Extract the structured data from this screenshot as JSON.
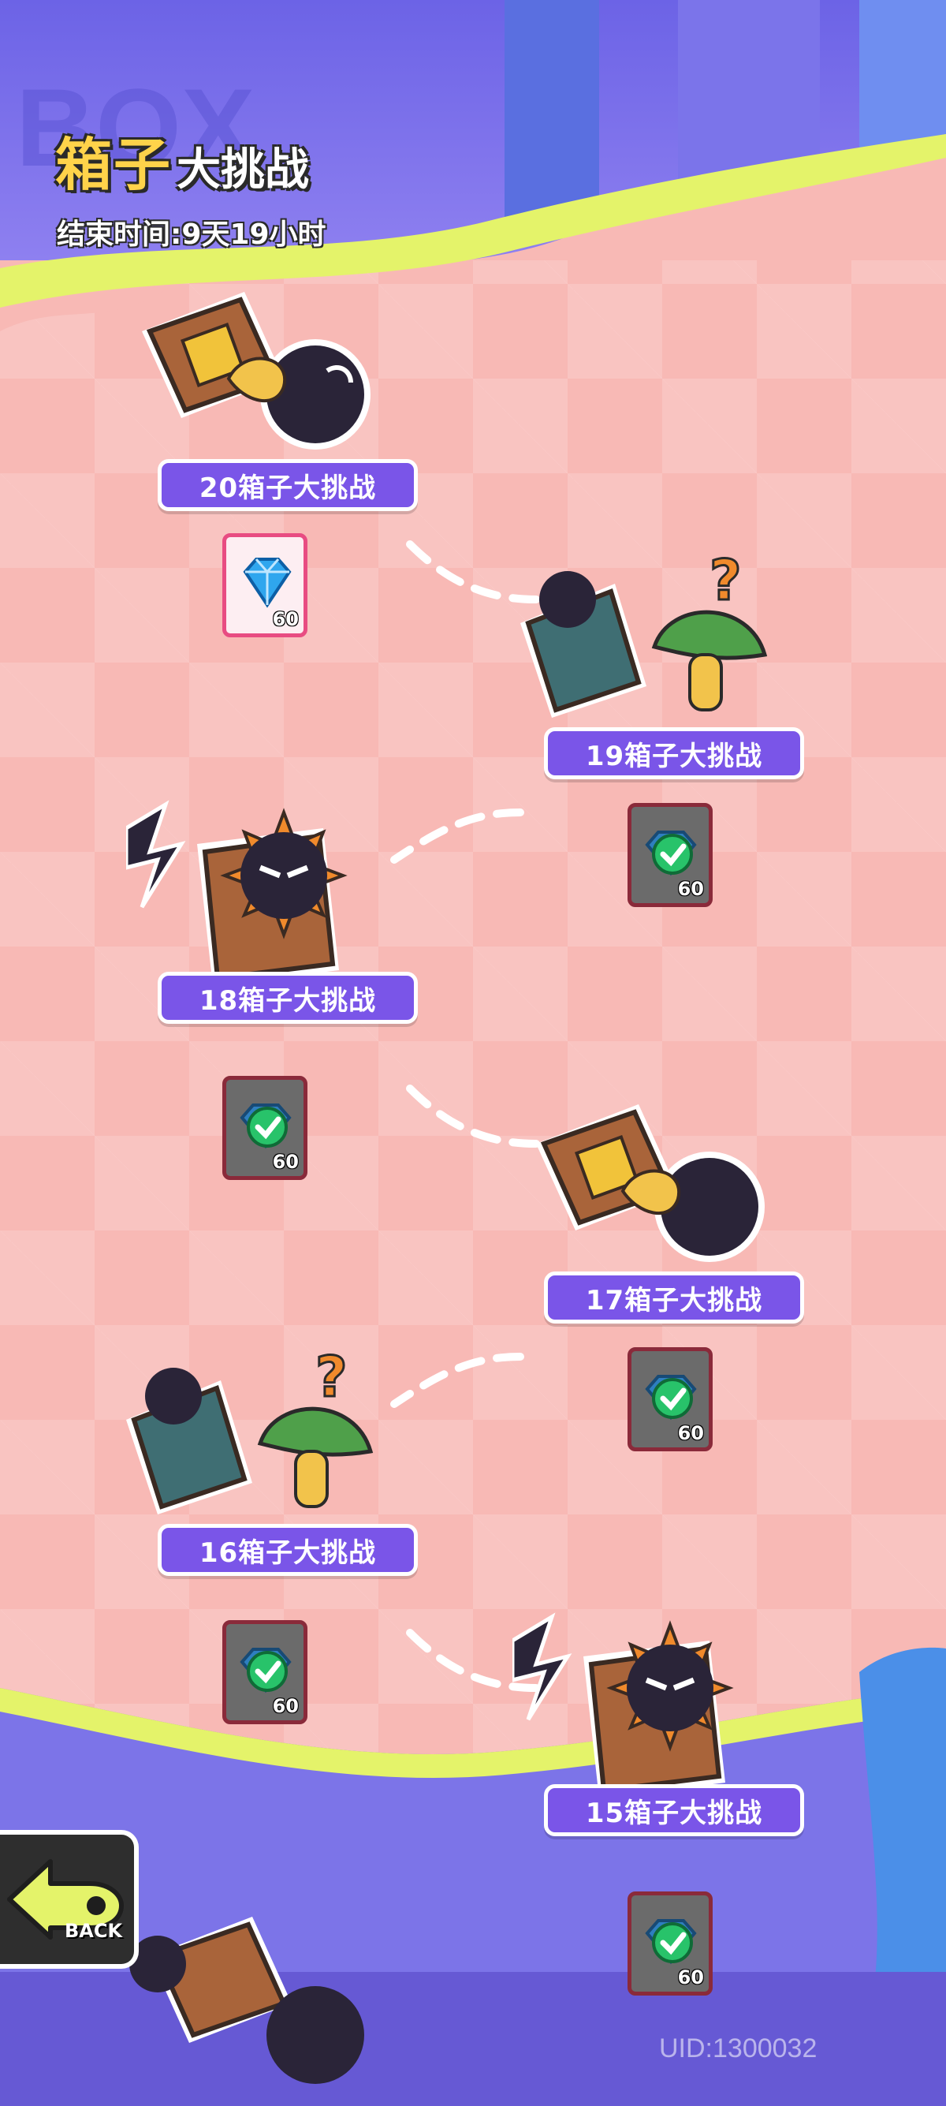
{
  "header": {
    "title_main": "箱子",
    "title_sub": "大挑战",
    "end_time": "结束时间:9天19小时",
    "bg_watermark": "BOX"
  },
  "levels": [
    {
      "label": "20箱子大挑战",
      "reward_count": "60",
      "reward_icon": "blue-diamond-icon",
      "claimed": false
    },
    {
      "label": "19箱子大挑战",
      "reward_count": "60",
      "reward_icon": "claimed-check-icon",
      "claimed": true
    },
    {
      "label": "18箱子大挑战",
      "reward_count": "60",
      "reward_icon": "claimed-check-icon",
      "claimed": true
    },
    {
      "label": "17箱子大挑战",
      "reward_count": "60",
      "reward_icon": "claimed-check-icon",
      "claimed": true
    },
    {
      "label": "16箱子大挑战",
      "reward_count": "60",
      "reward_icon": "claimed-check-icon",
      "claimed": true
    },
    {
      "label": "15箱子大挑战",
      "reward_count": "60",
      "reward_icon": "claimed-check-icon",
      "claimed": true
    }
  ],
  "back_button": {
    "label": "BACK"
  },
  "uid": "UID:1300032",
  "colors": {
    "accent": "#7a55e8",
    "background": "#f8b9b5",
    "highlight": "#e4f36a",
    "title": "#ffd34a"
  }
}
